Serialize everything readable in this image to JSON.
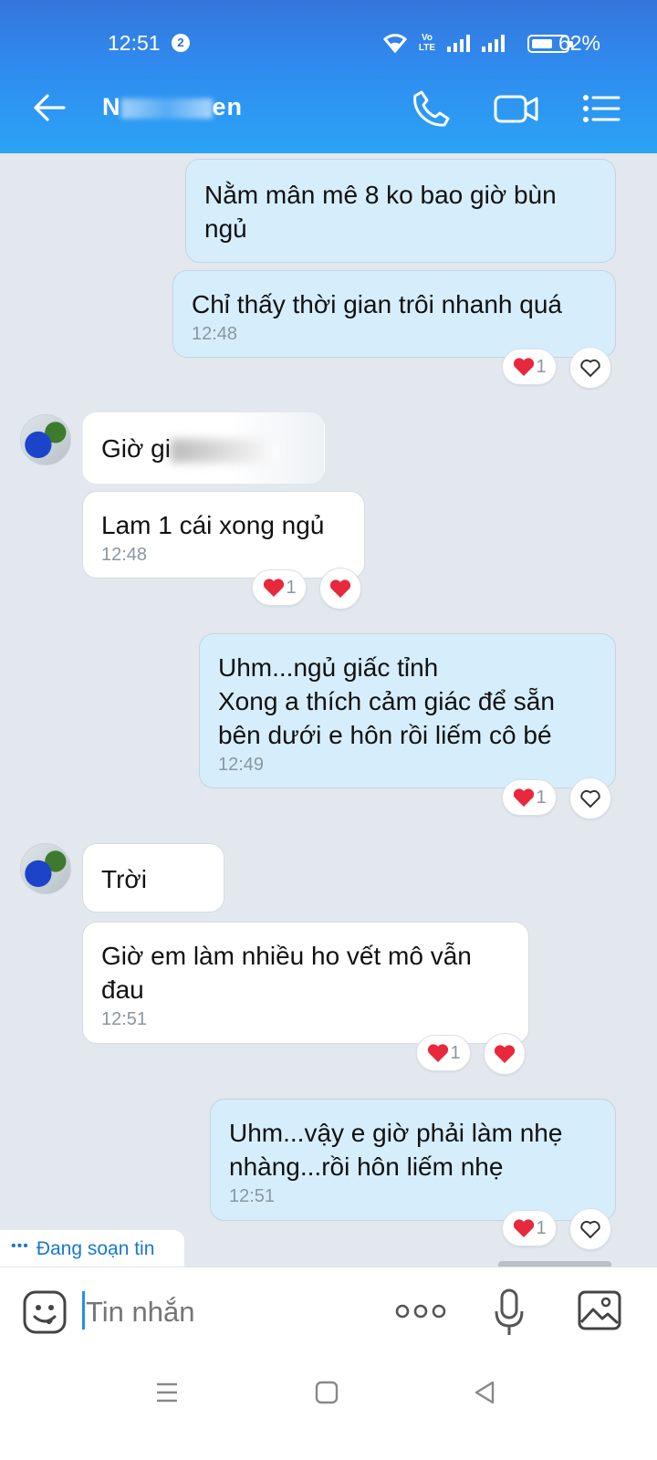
{
  "status_bar": {
    "time": "12:51",
    "notification_count": "2",
    "volte_label": "Vo LTE",
    "battery_percent": "62%",
    "battery_level": 0.62
  },
  "header": {
    "contact_name_visible_start": "N",
    "contact_name_visible_end": "en"
  },
  "messages": [
    {
      "dir": "out",
      "text": "Nằm mân mê 8 ko bao giờ bùn ngủ"
    },
    {
      "dir": "out",
      "text": "Chỉ thấy thời gian trôi nhanh quá",
      "time": "12:48",
      "reaction_count": "1"
    },
    {
      "dir": "in",
      "text_visible": "Giờ gi"
    },
    {
      "dir": "in",
      "text": "Lam 1 cái xong ngủ",
      "time": "12:48",
      "reaction_count": "1"
    },
    {
      "dir": "out",
      "lines": [
        "Uhm...ngủ giấc tỉnh",
        "Xong a thích cảm giác để sẵn",
        "bên dưới e hôn rồi liếm cô bé"
      ],
      "time": "12:49",
      "reaction_count": "1"
    },
    {
      "dir": "in",
      "text": "Trời"
    },
    {
      "dir": "in",
      "lines": [
        "Giờ em làm nhiều ho vết mô vẫn",
        "đau"
      ],
      "time": "12:51",
      "reaction_count": "1"
    },
    {
      "dir": "out",
      "lines": [
        "Uhm...vậy e giờ phải làm nhẹ",
        "nhàng...rồi hôn liếm nhẹ"
      ],
      "time": "12:51",
      "reaction_count": "1"
    }
  ],
  "typing_indicator": "Đang soạn tin",
  "input": {
    "placeholder": "Tin nhắn"
  },
  "colors": {
    "header_gradient_top": "#3575dc",
    "header_gradient_bottom": "#2aa3f5",
    "outgoing_bubble": "#d6eefc",
    "incoming_bubble": "#ffffff",
    "chat_background": "#e2e8ee",
    "heart": "#e8283c"
  },
  "icons": [
    "back-arrow-icon",
    "phone-icon",
    "video-call-icon",
    "menu-list-icon",
    "heart-icon",
    "heart-outline-icon",
    "sticker-icon",
    "more-dots-icon",
    "microphone-icon",
    "gallery-icon",
    "nav-menu-icon",
    "nav-home-icon",
    "nav-back-icon"
  ]
}
